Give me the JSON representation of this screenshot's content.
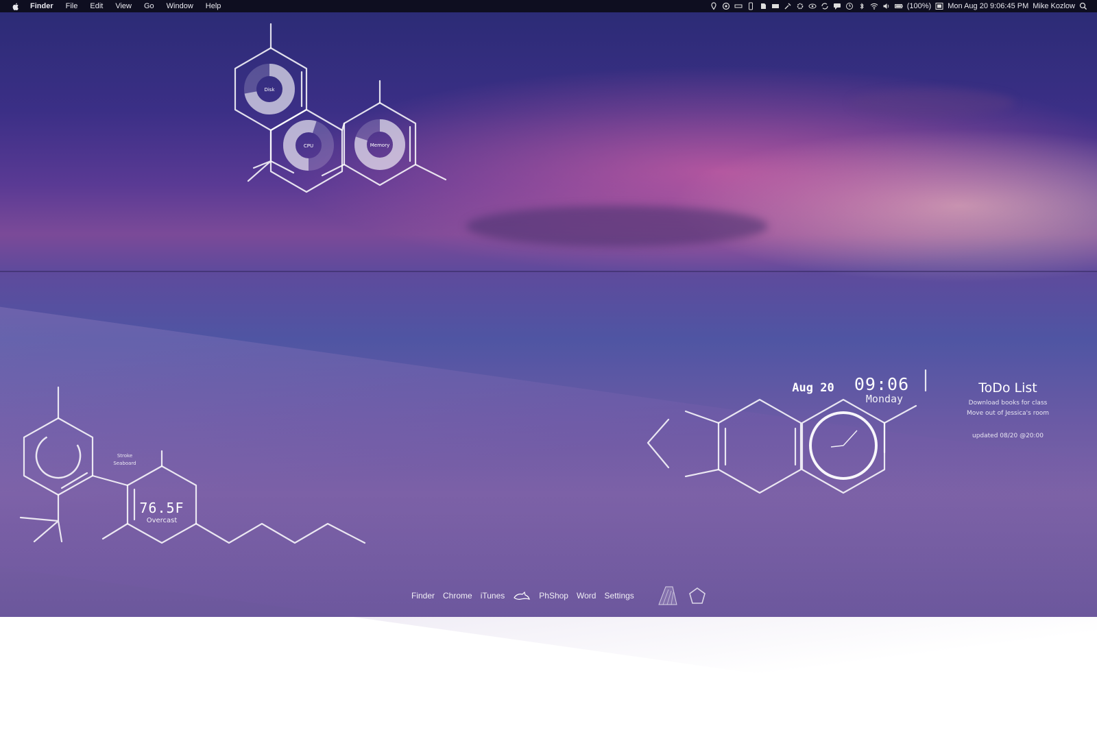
{
  "menubar": {
    "app": "Finder",
    "menus": [
      "File",
      "Edit",
      "View",
      "Go",
      "Window",
      "Help"
    ],
    "battery": "(100%)",
    "datetime": "Mon Aug 20  9:06:45 PM",
    "user": "Mike Kozlow",
    "status_icons": [
      "location-icon",
      "dropbox-icon",
      "ram-icon",
      "phone-icon",
      "evernote-icon",
      "menu-icon",
      "tool-icon",
      "settings-icon",
      "eye-icon",
      "sync-icon",
      "chat-icon",
      "time-machine-icon",
      "bluetooth-icon",
      "wifi-icon",
      "volume-icon",
      "battery-icon",
      "display-icon",
      "spotlight-icon"
    ]
  },
  "system_monitor": {
    "labels": [
      "Disk",
      "CPU",
      "Memory"
    ],
    "levels": [
      0.72,
      0.55,
      0.8
    ]
  },
  "weather": {
    "location_line1": "Stroke",
    "location_line2": "Seaboard",
    "temperature": "76.5F",
    "condition": "Overcast"
  },
  "clock": {
    "date": "Aug 20",
    "time": "09:06",
    "day": "Monday"
  },
  "todo": {
    "title": "ToDo List",
    "items": [
      "Download books for class",
      "Move out of Jessica's room"
    ],
    "updated": "updated 08/20 @20:00"
  },
  "dock": {
    "items": [
      "Finder",
      "Chrome",
      "iTunes",
      "PhShop",
      "Word",
      "Settings"
    ]
  },
  "colors": {
    "widget_stroke": "#ffffff",
    "menubar_bg": "#0a0a14",
    "ring_fill": "#ffffff"
  }
}
